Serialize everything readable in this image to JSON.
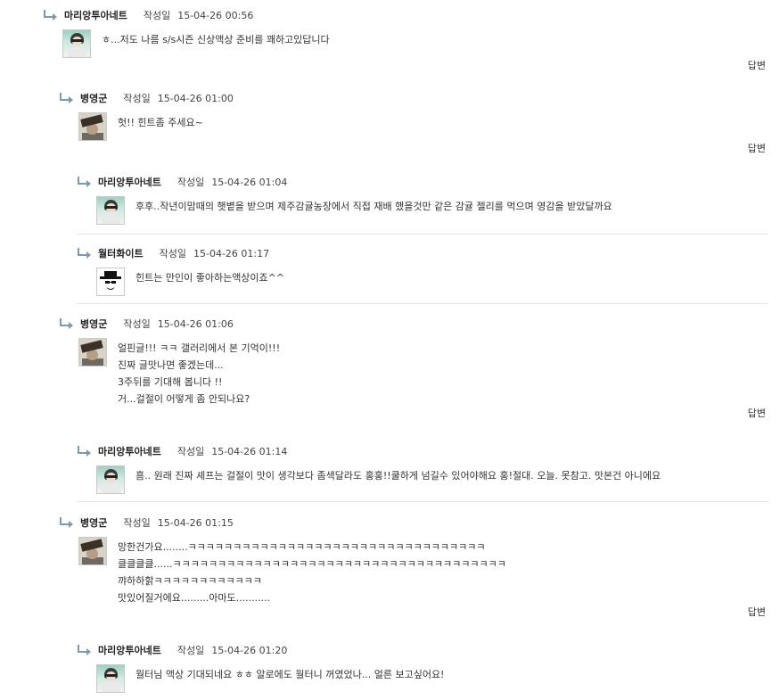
{
  "labels": {
    "written": "작성일",
    "reply": "답변"
  },
  "comments": [
    {
      "author": "마리앙투아네트",
      "date": "15-04-26 00:56",
      "avatar": "girl-avatar",
      "lines": [
        "ㅎ...저도 나름 s/s시즌 신상액상 준비를 꽤하고있답니다"
      ],
      "reply": true
    },
    {
      "author": "병영군",
      "date": "15-04-26 01:00",
      "avatar": "man-avatar",
      "lines": [
        "헛!! 힌트좀 주세요~"
      ],
      "reply": true
    },
    {
      "author": "마리앙투아네트",
      "date": "15-04-26 01:04",
      "avatar": "girl-avatar",
      "lines": [
        "후후..작년이맘때의 햇볕을 받으며 제주감귤농장에서 직접 재배 했을것만 같은 감귤 젤리를 먹으며 영감을 받았달까요"
      ],
      "reply": false
    },
    {
      "author": "월터화이트",
      "date": "15-04-26 01:17",
      "avatar": "heisenberg-avatar",
      "lines": [
        "힌트는 만인이 좋아하는액상이죠^^"
      ],
      "reply": false
    },
    {
      "author": "병영군",
      "date": "15-04-26 01:06",
      "avatar": "man-avatar",
      "lines": [
        "얼핀글!!! ㅋㅋ 갤러리에서 본 기억이!!!",
        "진짜 글맛나면 좋겠는데...",
        "3주뒤를 기대해 봅니다 !!",
        "거...걸절이 어떻게 좀 안되나요?"
      ],
      "reply": true
    },
    {
      "author": "마리앙투아네트",
      "date": "15-04-26 01:14",
      "avatar": "girl-avatar",
      "lines": [
        "흠.. 원래 진짜 셰프는    걸절이 맛이 생각보다 좀색달라도 홍홍!!쿨하게 넘길수 있어야해요 홍!절대. 오늘. 못참고. 맛본건 아니에요"
      ],
      "reply": false
    },
    {
      "author": "병영군",
      "date": "15-04-26 01:15",
      "avatar": "man-avatar",
      "lines": [
        "망한건가요........ㅋㅋㅋㅋㅋㅋㅋㅋㅋㅋㅋㅋㅋㅋㅋㅋㅋㅋㅋㅋㅋㅋㅋㅋㅋㅋㅋㅋㅋㅋㅋㅋㅋ",
        "클클클클......ㅋㅋㅋㅋㅋㅋㅋㅋㅋㅋㅋㅋㅋㅋㅋㅋㅋㅋㅋㅋㅋㅋㅋㅋㅋㅋㅋㅋㅋㅋㅋㅋㅋㅋㅋㅋㅋ",
        "꺄하하핡ㅋㅋㅋㅋㅋㅋㅋㅋㅋㅋㅋㅋ",
        "맛있어질거에요.........아마도..........."
      ],
      "reply": true
    },
    {
      "author": "마리앙투아네트",
      "date": "15-04-26 01:20",
      "avatar": "girl-avatar",
      "lines": [
        "월터님 액상 기대되네요 ㅎㅎ 알로에도 월터니 꺼였었나... 얼른 보고싶어요!"
      ],
      "reply": false
    }
  ]
}
